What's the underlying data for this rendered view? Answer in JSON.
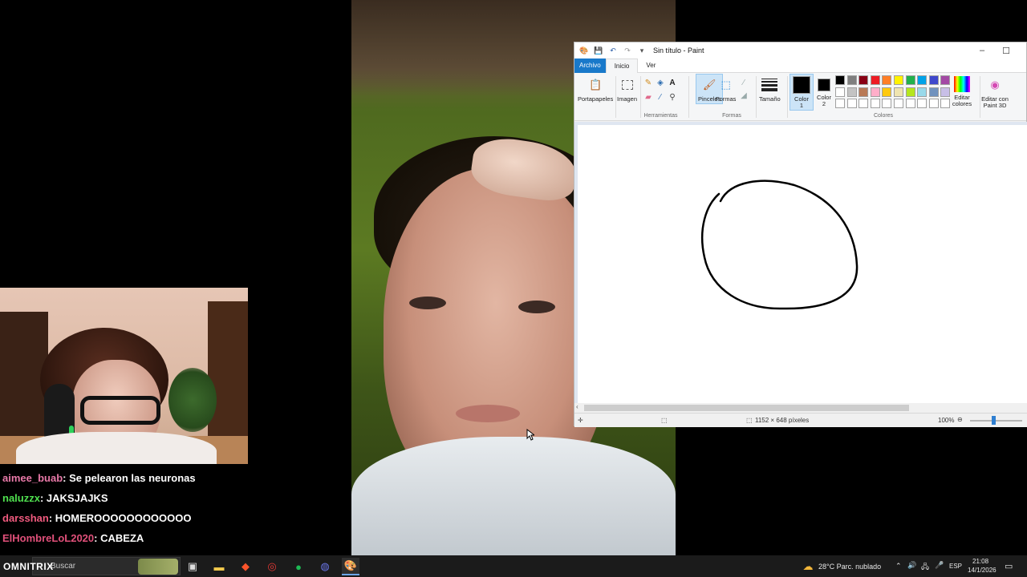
{
  "chat": [
    {
      "user": "aimee_buab",
      "color": "#e879a8",
      "text": "Se pelearon las neuronas"
    },
    {
      "user": "naluzzx",
      "color": "#4fe04f",
      "text": "JAKSJAJKS"
    },
    {
      "user": "darsshan",
      "color": "#ef5a7e",
      "text": "HOMEROOOOOOOOOOOO"
    },
    {
      "user": "ElHombreLoL2020",
      "color": "#e0507a",
      "text": "CABEZA"
    }
  ],
  "paint": {
    "title": "Sin título - Paint",
    "menu": {
      "file": "Archivo",
      "home": "Inicio",
      "view": "Ver"
    },
    "groups": {
      "clipboard": "Portapapeles",
      "image": "Imagen",
      "tools": "Herramientas",
      "brushes": "Pinceles",
      "shapes": "Formas",
      "size": "Tamaño",
      "color1": "Color 1",
      "color2": "Color 2",
      "colors": "Colores",
      "edit_colors": "Editar colores",
      "paint3d": "Editar con Paint 3D",
      "shapes_group": "Formas"
    },
    "palette": [
      "#000000",
      "#7f7f7f",
      "#880015",
      "#ed1c24",
      "#ff7f27",
      "#fff200",
      "#22b14c",
      "#00a2e8",
      "#3f48cc",
      "#a349a4",
      "#ffffff",
      "#c3c3c3",
      "#b97a57",
      "#ffaec9",
      "#ffc90e",
      "#efe4b0",
      "#b5e61d",
      "#99d9ea",
      "#7092be",
      "#c8bfe7"
    ],
    "status": {
      "dimensions": "1152 × 648 píxeles",
      "zoom": "100%"
    }
  },
  "taskbar": {
    "logo": "OMNITRIX",
    "search_placeholder": "Buscar",
    "weather": "28°C  Parc. nublado",
    "lang": "ESP",
    "time": "21:08",
    "date": "14/1/2026"
  }
}
